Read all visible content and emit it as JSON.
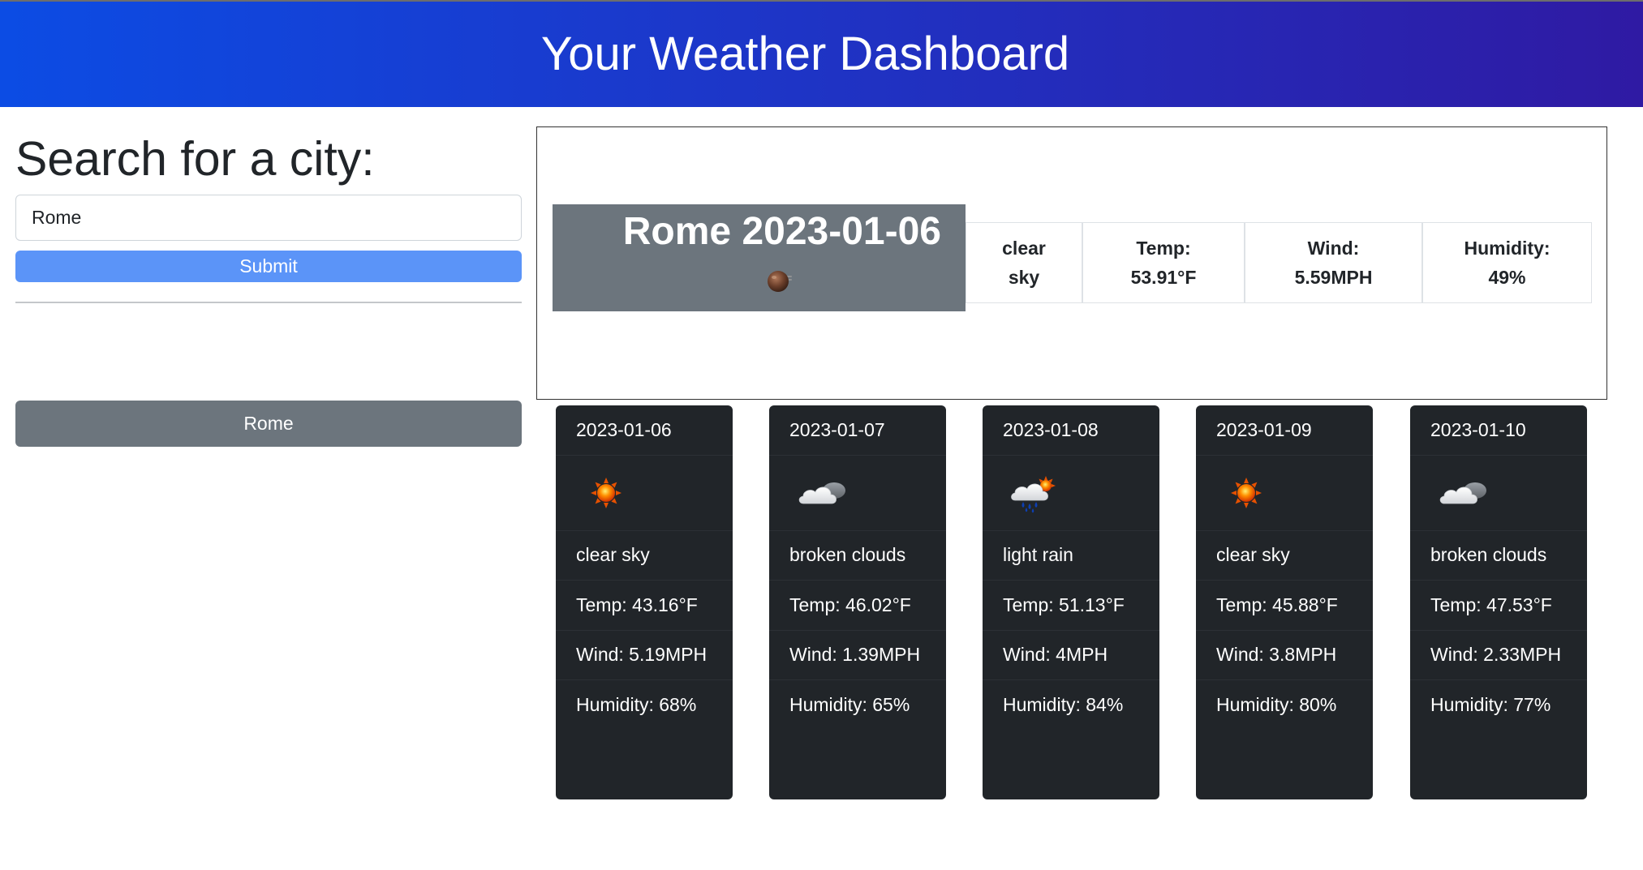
{
  "header": {
    "title": "Your Weather Dashboard"
  },
  "search": {
    "title": "Search for a city:",
    "input_value": "Rome",
    "submit_label": "Submit"
  },
  "history": [
    {
      "label": "Rome"
    }
  ],
  "current": {
    "city_date": "Rome 2023-01-06",
    "icon": "moon-haze-icon",
    "description": {
      "line1": "clear",
      "line2": "sky"
    },
    "temp": {
      "label": "Temp:",
      "value": "53.91°F"
    },
    "wind": {
      "label": "Wind:",
      "value": "5.59MPH"
    },
    "humidity": {
      "label": "Humidity:",
      "value": "49%"
    }
  },
  "forecast": [
    {
      "date": "2023-01-06",
      "icon": "sun-icon",
      "description": "clear sky",
      "temp": "Temp: 43.16°F",
      "wind": "Wind: 5.19MPH",
      "humidity": "Humidity: 68%"
    },
    {
      "date": "2023-01-07",
      "icon": "broken-clouds-icon",
      "description": "broken clouds",
      "temp": "Temp: 46.02°F",
      "wind": "Wind: 1.39MPH",
      "humidity": "Humidity: 65%"
    },
    {
      "date": "2023-01-08",
      "icon": "light-rain-icon",
      "description": "light rain",
      "temp": "Temp: 51.13°F",
      "wind": "Wind: 4MPH",
      "humidity": "Humidity: 84%"
    },
    {
      "date": "2023-01-09",
      "icon": "sun-icon",
      "description": "clear sky",
      "temp": "Temp: 45.88°F",
      "wind": "Wind: 3.8MPH",
      "humidity": "Humidity: 80%"
    },
    {
      "date": "2023-01-10",
      "icon": "broken-clouds-icon",
      "description": "broken clouds",
      "temp": "Temp: 47.53°F",
      "wind": "Wind: 2.33MPH",
      "humidity": "Humidity: 77%"
    }
  ],
  "colors": {
    "header_gradient_start": "#0c4ce4",
    "header_gradient_end": "#2f1aa3",
    "submit_button": "#5b94f8",
    "history_button": "#6c757d",
    "current_head_bg": "#6c757d",
    "forecast_card_bg": "#212529"
  }
}
